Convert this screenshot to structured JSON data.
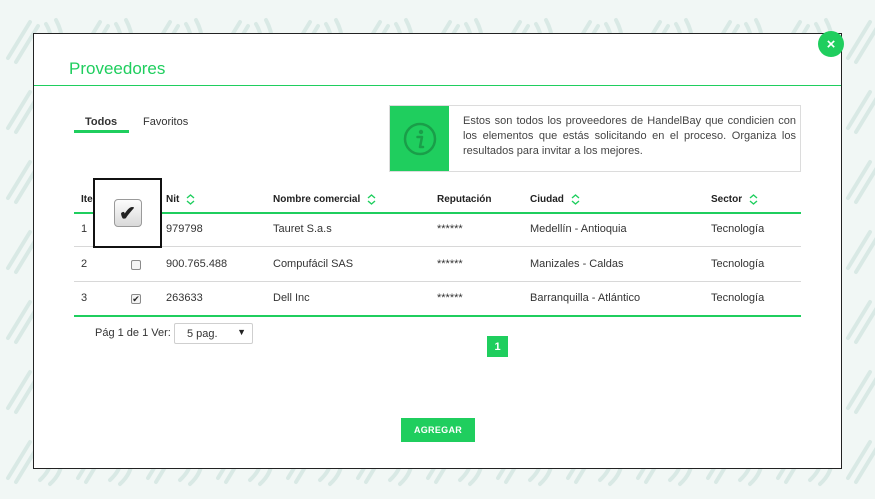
{
  "colors": {
    "accent": "#1fce5e",
    "text": "#333333"
  },
  "modal": {
    "title": "Proveedores",
    "close_label": "×"
  },
  "tabs": [
    {
      "label": "Todos",
      "active": true
    },
    {
      "label": "Favoritos",
      "active": false
    }
  ],
  "info": {
    "icon": "info-icon",
    "text": "Estos son todos los proveedores de HandelBay que condicien con los elementos que estás solicitando en el proceso. Organiza los resultados para invitar a los mejores."
  },
  "table": {
    "headers": {
      "item": "Ite",
      "nit": "Nit",
      "name": "Nombre comercial",
      "reputation": "Reputación",
      "city": "Ciudad",
      "sector": "Sector"
    },
    "rows": [
      {
        "item": "1",
        "checked": true,
        "nit": "979798",
        "name": "Tauret S.a.s",
        "reputation": "******",
        "city": "Medellín - Antioquia",
        "sector": "Tecnología"
      },
      {
        "item": "2",
        "checked": false,
        "nit": "900.765.488",
        "name": "Compufácil SAS",
        "reputation": "******",
        "city": "Manizales - Caldas",
        "sector": "Tecnología"
      },
      {
        "item": "3",
        "checked": true,
        "nit": "263633",
        "name": "Dell Inc",
        "reputation": "******",
        "city": "Barranquilla - Atlántico",
        "sector": "Tecnología"
      }
    ]
  },
  "pagination": {
    "label": "Pág 1 de 1 Ver:",
    "per_page": "5 pag.",
    "current_page": "1"
  },
  "actions": {
    "add_label": "AGREGAR"
  }
}
